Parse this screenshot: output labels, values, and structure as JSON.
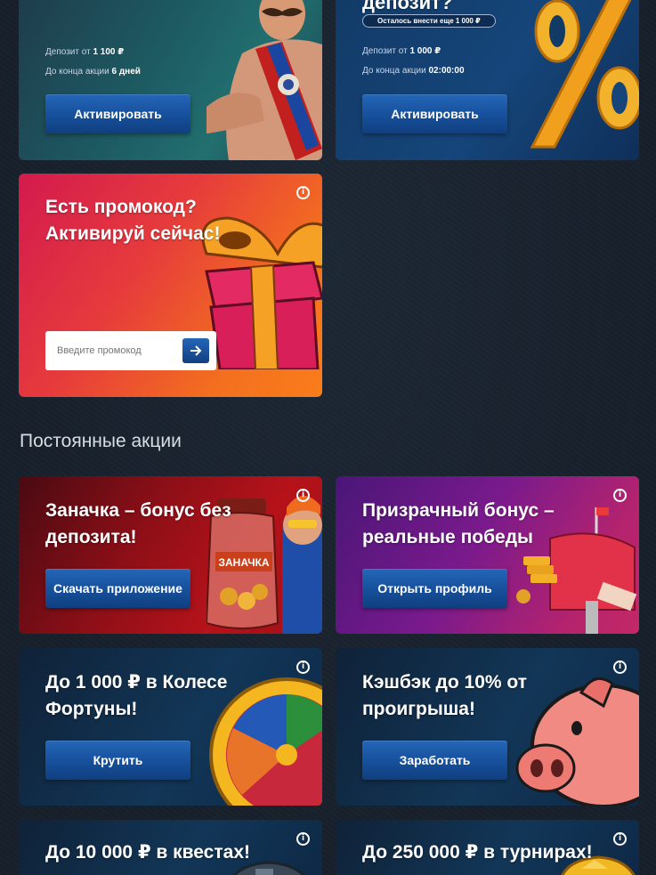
{
  "top_cards": [
    {
      "deposit_label": "Депозит от",
      "deposit_value": "1 100 ₽",
      "time_label": "До конца акции",
      "time_value": "6 дней",
      "button": "Активировать"
    },
    {
      "title_partial": "депозит?",
      "remaining": "Осталось внести еще 1 000 ₽",
      "deposit_label": "Депозит от",
      "deposit_value": "1 000 ₽",
      "time_label": "До конца акции",
      "time_value": "02:00:00",
      "button": "Активировать"
    }
  ],
  "promo": {
    "title_line1": "Есть промокод?",
    "title_line2": "Активируй сейчас!",
    "input_placeholder": "Введите промокод"
  },
  "section_title": "Постоянные акции",
  "cards": [
    {
      "line1": "Заначка – бонус без",
      "line2": "депозита!",
      "button": "Скачать приложение",
      "jar_label": "ЗАНАЧКА"
    },
    {
      "line1": "Призрачный бонус –",
      "line2": "реальные победы",
      "button": "Открыть профиль"
    },
    {
      "line1": "До 1 000 ₽ в Колесе",
      "line2": "Фортуны!",
      "button": "Крутить"
    },
    {
      "line1": "Кэшбэк до 10% от",
      "line2": "проигрыша!",
      "button": "Заработать"
    },
    {
      "line1": "До 10 000 ₽ в квестах!"
    },
    {
      "line1": "До 250 000 ₽ в турнирах!"
    }
  ],
  "colors": {
    "page_bg": "#17202b",
    "button_blue": "#1a56a6",
    "promo_orange": "#f36f1f",
    "promo_magenta": "#d3174f"
  },
  "icons": [
    "info-icon",
    "arrow-right-icon",
    "percent-icon",
    "gift-icon",
    "jar-icon",
    "mailbox-icon",
    "fortune-wheel-icon",
    "piggy-bank-icon",
    "chest-icon",
    "trophy-icon"
  ]
}
